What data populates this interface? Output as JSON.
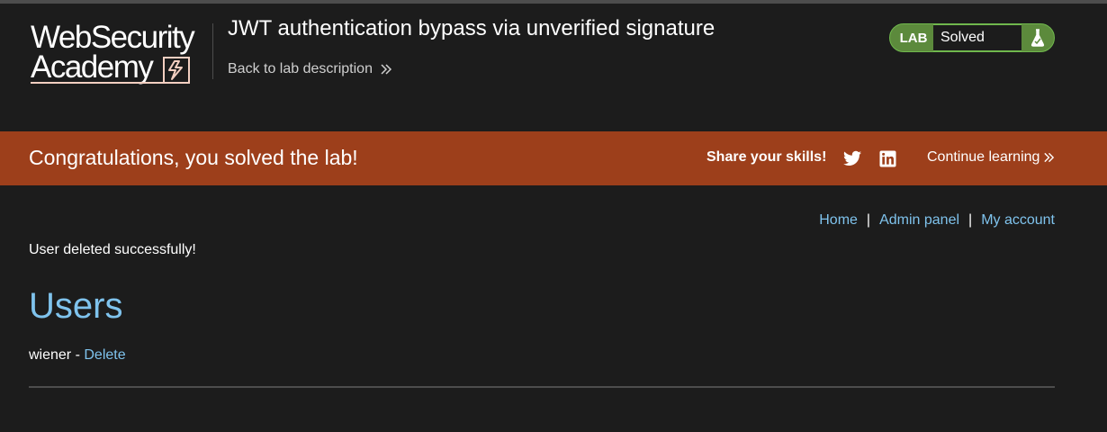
{
  "header": {
    "logo_line1": "WebSecurity",
    "logo_line2": "Academy",
    "lab_title": "JWT authentication bypass via unverified signature",
    "back_link": "Back to lab description",
    "lab_status": {
      "label": "LAB",
      "value": "Solved",
      "icon": "flask-icon"
    }
  },
  "banner": {
    "title": "Congratulations, you solved the lab!",
    "share_label": "Share your skills!",
    "share_icons": [
      "twitter-icon",
      "linkedin-icon"
    ],
    "continue_link": "Continue learning"
  },
  "nav": {
    "home": "Home",
    "sep1": "|",
    "admin_panel": "Admin panel",
    "sep2": "|",
    "my_account": "My account"
  },
  "main": {
    "message": "User deleted successfully!",
    "heading": "Users",
    "users": [
      {
        "name": "wiener",
        "separator": " - ",
        "action": "Delete"
      }
    ]
  },
  "colors": {
    "background": "#1c1c1c",
    "banner": "#9d3f1b",
    "link": "#7fc3ed",
    "lab_green": "#70b84d",
    "logo_accent": "#f3cfc1"
  }
}
